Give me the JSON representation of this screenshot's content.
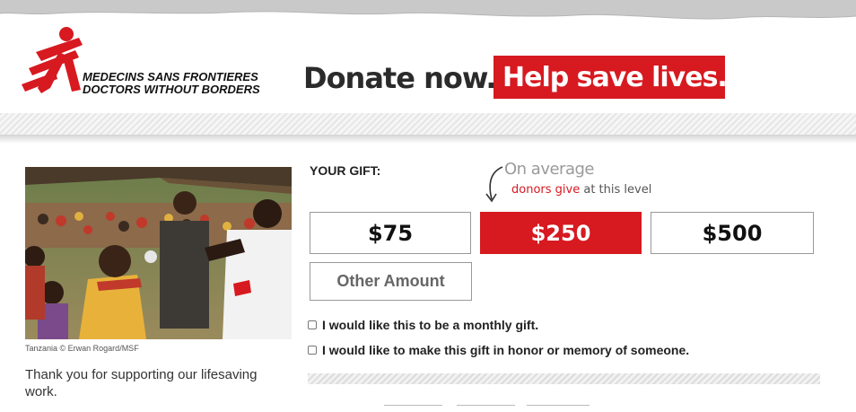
{
  "brand": {
    "logo_line1": "MEDECINS SANS FRONTIERES",
    "logo_line2": "DOCTORS WITHOUT BORDERS",
    "accent_color": "#d71920"
  },
  "header": {
    "tagline_plain": "Donate now.",
    "tagline_highlight": "Help save lives."
  },
  "photo": {
    "caption": "Tanzania © Erwan Rogard/MSF"
  },
  "sidebar": {
    "thanks_text": "Thank you for supporting our lifesaving work."
  },
  "gift": {
    "label": "YOUR GIFT:",
    "note_line1": "On average",
    "note_red": "donors give",
    "note_rest": " at this level",
    "amounts": [
      {
        "label": "$75",
        "selected": false
      },
      {
        "label": "$250",
        "selected": true
      },
      {
        "label": "$500",
        "selected": false
      }
    ],
    "other_label": "Other Amount",
    "monthly_label": "I would like this to be a monthly gift.",
    "tribute_label": "I would like to make this gift in honor or memory of someone."
  }
}
